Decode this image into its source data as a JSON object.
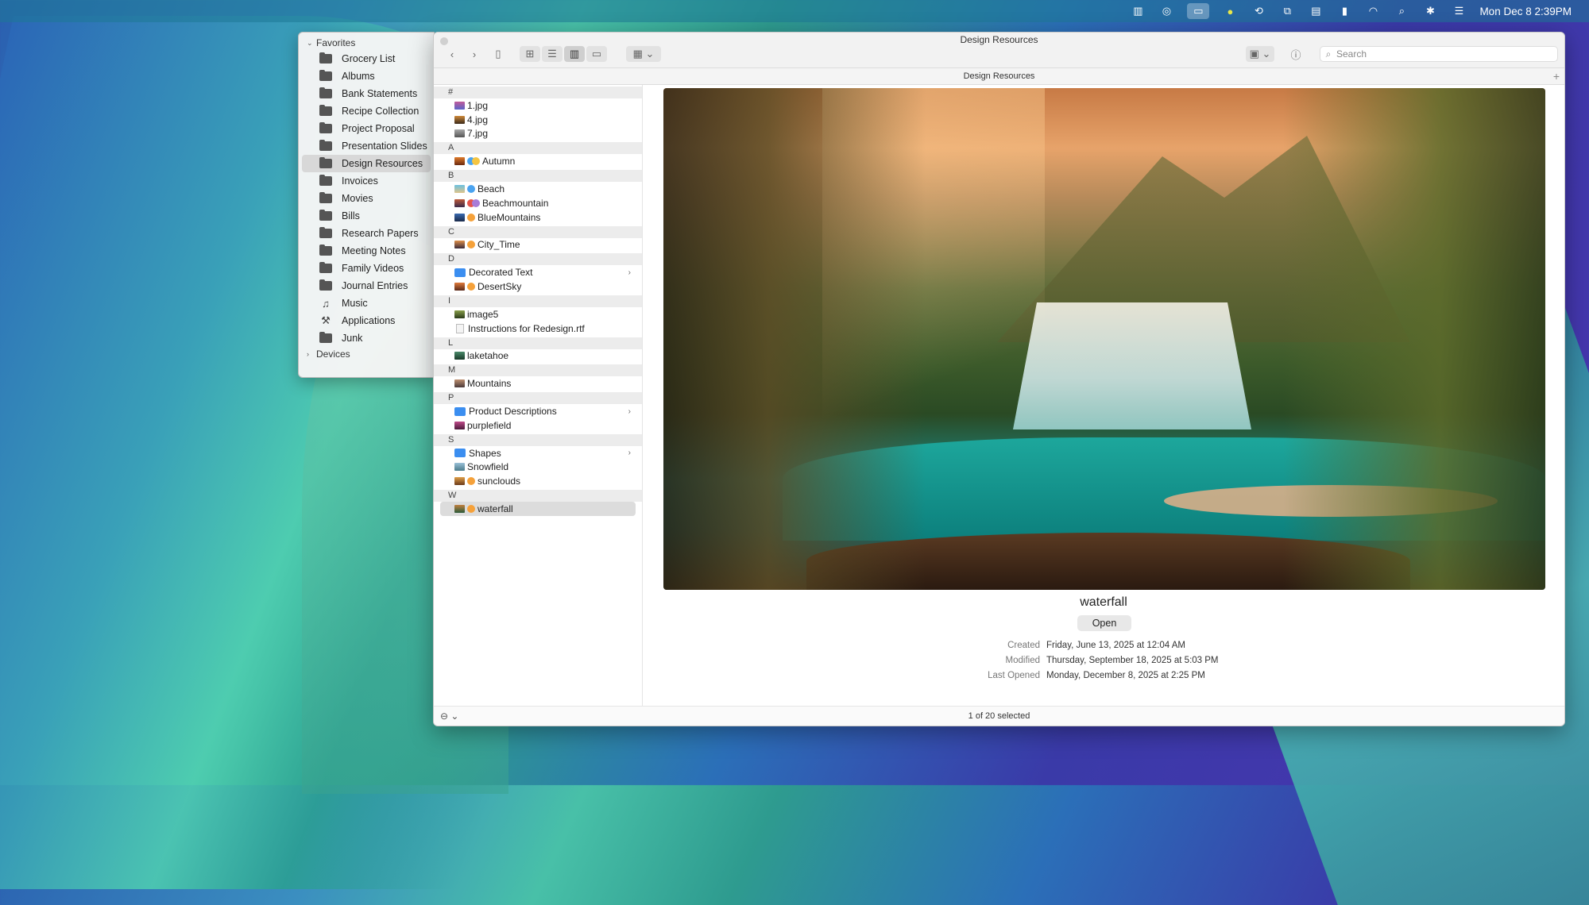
{
  "menubar": {
    "datetime": "Mon Dec 8  2:39PM",
    "icons": [
      "levels-icon",
      "check-icon",
      "finder-icon",
      "cat-icon",
      "timemachine-icon",
      "window-icon",
      "card-icon",
      "battery-icon",
      "wifi-icon",
      "search-icon",
      "bluetooth-icon",
      "control-center-icon"
    ]
  },
  "sidebar": {
    "favorites_label": "Favorites",
    "devices_label": "Devices",
    "items": [
      {
        "label": "Grocery List",
        "icon": "folder"
      },
      {
        "label": "Albums",
        "icon": "folder"
      },
      {
        "label": "Bank Statements",
        "icon": "folder"
      },
      {
        "label": "Recipe Collection",
        "icon": "folder"
      },
      {
        "label": "Project Proposal",
        "icon": "folder"
      },
      {
        "label": "Presentation Slides",
        "icon": "folder"
      },
      {
        "label": "Design Resources",
        "icon": "folder",
        "selected": true
      },
      {
        "label": "Invoices",
        "icon": "folder"
      },
      {
        "label": "Movies",
        "icon": "folder"
      },
      {
        "label": "Bills",
        "icon": "folder"
      },
      {
        "label": "Research Papers",
        "icon": "folder"
      },
      {
        "label": "Meeting Notes",
        "icon": "folder"
      },
      {
        "label": "Family Videos",
        "icon": "folder"
      },
      {
        "label": "Journal Entries",
        "icon": "folder"
      },
      {
        "label": "Music",
        "icon": "music-note"
      },
      {
        "label": "Applications",
        "icon": "applications"
      },
      {
        "label": "Junk",
        "icon": "folder"
      }
    ]
  },
  "window": {
    "title": "Design Resources",
    "path": "Design Resources",
    "search_placeholder": "Search",
    "status": "1 of 20 selected"
  },
  "files": {
    "s_hash": "#",
    "f_1jpg": "1.jpg",
    "f_4jpg": "4.jpg",
    "f_7jpg": "7.jpg",
    "s_a": "A",
    "f_autumn": "Autumn",
    "s_b": "B",
    "f_beach": "Beach",
    "f_beachmountain": "Beachmountain",
    "f_bluemountains": "BlueMountains",
    "s_c": "C",
    "f_citytime": "City_Time",
    "s_d": "D",
    "f_decorated": "Decorated Text",
    "f_desertsky": "DesertSky",
    "s_i": "I",
    "f_image5": "image5",
    "f_instructions": "Instructions for Redesign.rtf",
    "s_l": "L",
    "f_laketahoe": "laketahoe",
    "s_m": "M",
    "f_mountains": "Mountains",
    "s_p": "P",
    "f_productdesc": "Product Descriptions",
    "f_purplefield": "purplefield",
    "s_s": "S",
    "f_shapes": "Shapes",
    "f_snowfield": "Snowfield",
    "f_sunclouds": "sunclouds",
    "s_w": "W",
    "f_waterfall": "waterfall"
  },
  "tag_colors": {
    "orange": "#f5a13a",
    "blue": "#4aa3f0",
    "red": "#e5534b"
  },
  "preview": {
    "name": "waterfall",
    "open_label": "Open",
    "created_label": "Created",
    "created_value": "Friday, June 13, 2025 at 12:04 AM",
    "modified_label": "Modified",
    "modified_value": "Thursday, September 18, 2025 at 5:03 PM",
    "last_opened_label": "Last Opened",
    "last_opened_value": "Monday, December 8, 2025 at 2:25 PM"
  }
}
